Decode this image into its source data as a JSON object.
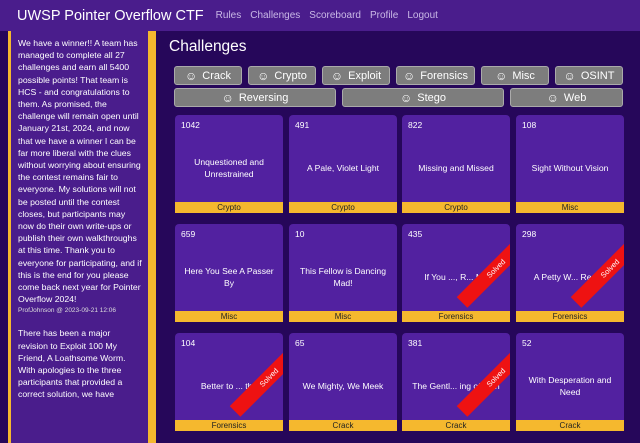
{
  "navbar": {
    "brand": "UWSP Pointer Overflow CTF",
    "links": [
      "Rules",
      "Challenges",
      "Scoreboard",
      "Profile",
      "Logout"
    ]
  },
  "sidebar": {
    "posts": [
      {
        "text": "We have a winner!! A team has managed to complete all 27 challenges and earn all 5400 possible points! That team is HCS - and congratulations to them. As promised, the challenge will remain open until January 21st, 2024, and now that we have a winner I can be far more liberal with the clues without worrying about ensuring the contest remains fair to everyone. My solutions will not be posted until the contest closes, but participants may now do their own write-ups or publish their own walkthroughs at this time. Thank you to everyone for participating, and if this is the end for you please come back next year for Pointer Overflow 2024!",
        "meta": "ProfJohnson @ 2023-09-21 12:06"
      },
      {
        "text": "There has been a major revision to Exploit 100 My Friend, A Loathsome Worm. With apologies to the three participants that provided a correct solution, we have",
        "meta": ""
      }
    ]
  },
  "main": {
    "title": "Challenges"
  },
  "categories": [
    "Crack",
    "Crypto",
    "Exploit",
    "Forensics",
    "Misc",
    "OSINT",
    "Reversing",
    "Stego",
    "Web"
  ],
  "solved_label": "Solved",
  "challenges": [
    {
      "points": "1042",
      "name": "Unquestioned and Unrestrained",
      "category": "Crypto",
      "solved": false
    },
    {
      "points": "491",
      "name": "A Pale, Violet Light",
      "category": "Crypto",
      "solved": false
    },
    {
      "points": "822",
      "name": "Missing and Missed",
      "category": "Crypto",
      "solved": false
    },
    {
      "points": "108",
      "name": "Sight Without Vision",
      "category": "Misc",
      "solved": false
    },
    {
      "points": "659",
      "name": "Here You See A Passer By",
      "category": "Misc",
      "solved": false
    },
    {
      "points": "10",
      "name": "This Fellow is Dancing Mad!",
      "category": "Misc",
      "solved": false
    },
    {
      "points": "435",
      "name": "If You ..., R... Me",
      "category": "Forensics",
      "solved": true
    },
    {
      "points": "298",
      "name": "A Petty W... Regret",
      "category": "Forensics",
      "solved": true
    },
    {
      "points": "104",
      "name": "Better to ... the",
      "category": "Forensics",
      "solved": true
    },
    {
      "points": "65",
      "name": "We Mighty, We Meek",
      "category": "Crack",
      "solved": false
    },
    {
      "points": "381",
      "name": "The Gentl... ing of ...un",
      "category": "Crack",
      "solved": true
    },
    {
      "points": "52",
      "name": "With Desperation and Need",
      "category": "Crack",
      "solved": false
    }
  ]
}
